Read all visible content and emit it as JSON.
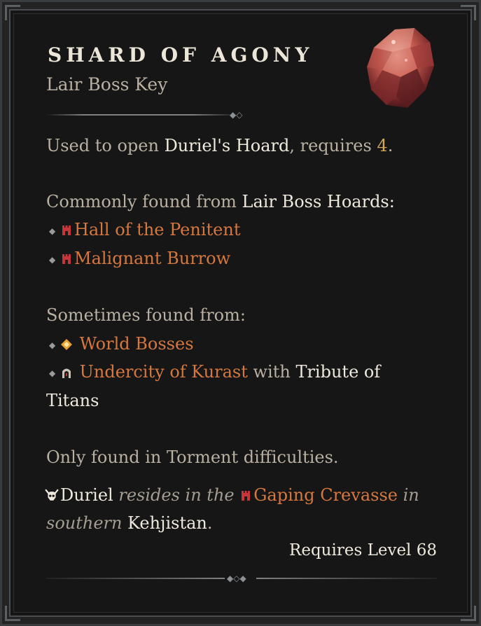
{
  "item": {
    "name": "SHARD OF AGONY",
    "type": "Lair Boss Key",
    "gem_icon": "red-gem-shard-icon"
  },
  "usage": {
    "prefix": "Used to open ",
    "target": "Duriel's Hoard",
    "middle": ", requires ",
    "count": "4",
    "suffix": "."
  },
  "common": {
    "heading_prefix": "Commonly found from ",
    "heading_source": "Lair Boss Hoards",
    "heading_suffix": ":",
    "items": [
      {
        "label": "Hall of the Penitent",
        "icon": "dungeon-icon"
      },
      {
        "label": "Malignant Burrow",
        "icon": "dungeon-icon"
      }
    ]
  },
  "sometimes": {
    "heading": "Sometimes found from:",
    "items": [
      {
        "label": "World Bosses",
        "icon": "world-boss-icon"
      },
      {
        "label": "Undercity of Kurast",
        "icon": "undercity-icon",
        "tail_plain": " with ",
        "tail_bold": "Tribute of",
        "tail_bold2": "Titans"
      }
    ]
  },
  "torment_note": "Only found in Torment difficulties.",
  "lore": {
    "boss": "Duriel",
    "phrase1": " resides in the ",
    "location": "Gaping Crevasse",
    "phrase2": " in",
    "line2_italic": "southern",
    "region": " Kehjistan",
    "end": "."
  },
  "requirement": "Requires Level 68",
  "colors": {
    "link": "#d6783e",
    "highlight": "#efe9dd",
    "muted": "#b9b0a2",
    "number": "#d3a65a"
  }
}
